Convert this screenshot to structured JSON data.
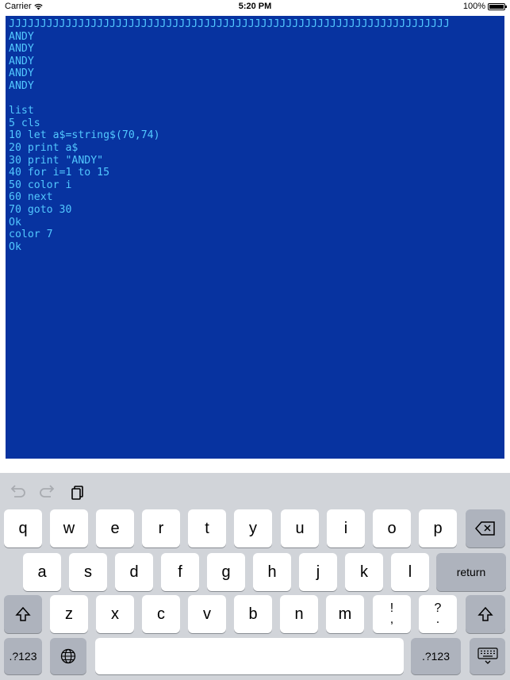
{
  "status_bar": {
    "carrier": "Carrier",
    "time": "5:20 PM",
    "battery": "100%"
  },
  "terminal": {
    "lines": [
      "JJJJJJJJJJJJJJJJJJJJJJJJJJJJJJJJJJJJJJJJJJJJJJJJJJJJJJJJJJJJJJJJJJJJJJ",
      "ANDY",
      "ANDY",
      "ANDY",
      "ANDY",
      "ANDY",
      "",
      "list",
      "5 cls",
      "10 let a$=string$(70,74)",
      "20 print a$",
      "30 print \"ANDY\"",
      "40 for i=1 to 15",
      "50 color i",
      "60 next",
      "70 goto 30",
      "Ok",
      "color 7",
      "Ok"
    ],
    "background_color": "#0733a0",
    "text_color": "#52c8ff"
  },
  "keyboard": {
    "assistant_icons": [
      "undo-icon",
      "redo-icon",
      "paste-icon"
    ],
    "row1": [
      "q",
      "w",
      "e",
      "r",
      "t",
      "y",
      "u",
      "i",
      "o",
      "p"
    ],
    "row2": [
      "a",
      "s",
      "d",
      "f",
      "g",
      "h",
      "j",
      "k",
      "l"
    ],
    "row3": [
      "z",
      "x",
      "c",
      "v",
      "b",
      "n",
      "m"
    ],
    "row3_punct": [
      {
        "top": "!",
        "bottom": ","
      },
      {
        "top": "?",
        "bottom": "."
      }
    ],
    "return_label": "return",
    "numbers_label": ".?123",
    "icons": {
      "backspace": "backspace-icon",
      "shift": "shift-icon",
      "globe": "globe-icon",
      "dismiss": "keyboard-dismiss-icon"
    }
  }
}
